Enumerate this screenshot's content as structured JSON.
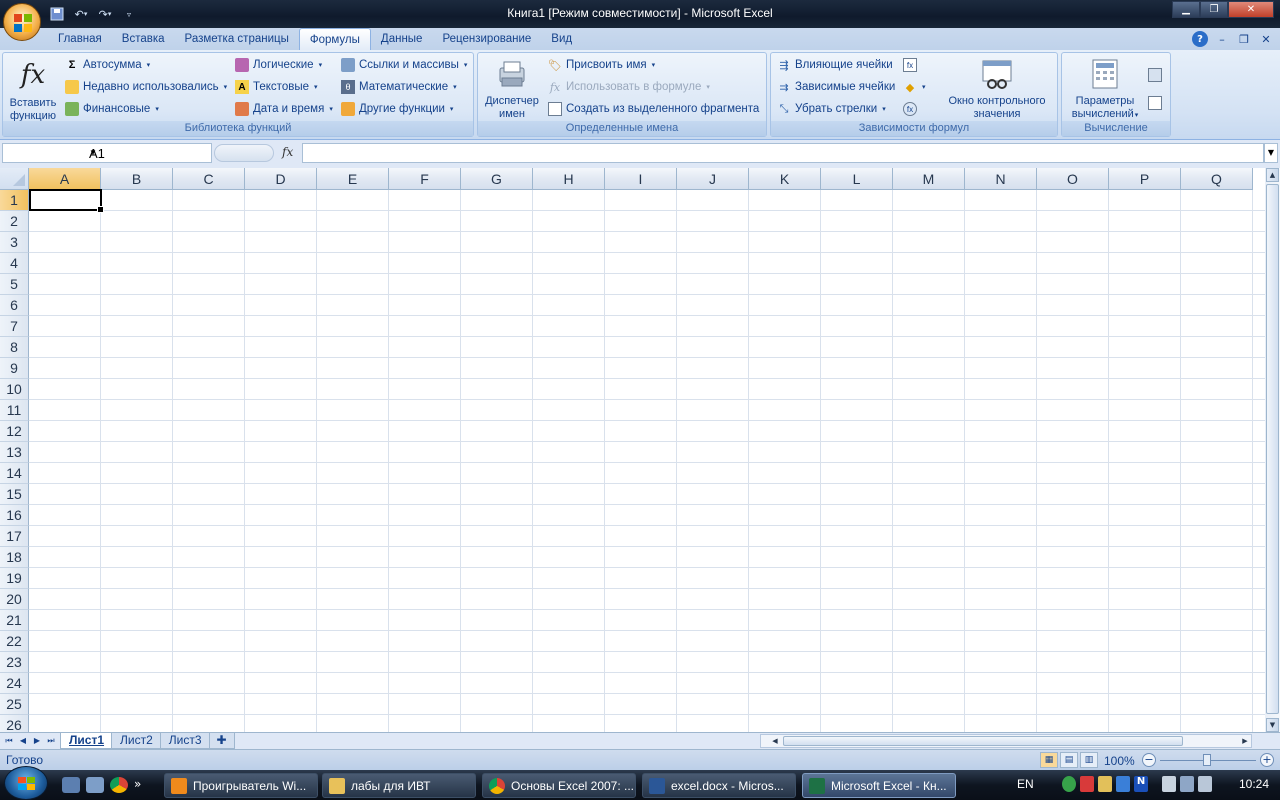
{
  "window": {
    "title": "Книга1  [Режим совместимости] - Microsoft Excel"
  },
  "tabs": [
    "Главная",
    "Вставка",
    "Разметка страницы",
    "Формулы",
    "Данные",
    "Рецензирование",
    "Вид"
  ],
  "active_tab": "Формулы",
  "ribbon": {
    "function_library": {
      "label": "Библиотека функций",
      "insert_function": "Вставить функцию",
      "insert_function_l1": "Вставить",
      "insert_function_l2": "функцию",
      "autosum": "Автосумма",
      "recent": "Недавно использовались",
      "financial": "Финансовые",
      "logical": "Логические",
      "text": "Текстовые",
      "datetime": "Дата и время",
      "lookup": "Ссылки и массивы",
      "math": "Математические",
      "more": "Другие функции"
    },
    "defined_names": {
      "label": "Определенные имена",
      "name_manager_l1": "Диспетчер",
      "name_manager_l2": "имен",
      "define_name": "Присвоить имя",
      "use_in_formula": "Использовать в формуле",
      "create_from_selection": "Создать из выделенного фрагмента"
    },
    "formula_auditing": {
      "label": "Зависимости формул",
      "trace_precedents": "Влияющие ячейки",
      "trace_dependents": "Зависимые ячейки",
      "remove_arrows": "Убрать стрелки",
      "watch_window_l1": "Окно контрольного",
      "watch_window_l2": "значения"
    },
    "calculation": {
      "label": "Вычисление",
      "options_l1": "Параметры",
      "options_l2": "вычислений"
    }
  },
  "formula_bar": {
    "name_box": "A1",
    "fx": "fx",
    "content": ""
  },
  "columns": [
    "A",
    "B",
    "C",
    "D",
    "E",
    "F",
    "G",
    "H",
    "I",
    "J",
    "K",
    "L",
    "M",
    "N",
    "O",
    "P",
    "Q"
  ],
  "rows": [
    "1",
    "2",
    "3",
    "4",
    "5",
    "6",
    "7",
    "8",
    "9",
    "10",
    "11",
    "12",
    "13",
    "14",
    "15",
    "16",
    "17",
    "18",
    "19",
    "20",
    "21",
    "22",
    "23",
    "24",
    "25",
    "26"
  ],
  "selected_cell": {
    "column": "A",
    "row": "1"
  },
  "sheets": [
    "Лист1",
    "Лист2",
    "Лист3"
  ],
  "active_sheet": "Лист1",
  "status": {
    "text": "Готово",
    "zoom": "100%"
  },
  "taskbar": {
    "items": [
      "Проигрыватель Wi...",
      "лабы для ИВТ",
      "Основы Excel 2007: ...",
      "excel.docx - Micros...",
      "Microsoft Excel - Кн..."
    ],
    "active_item": "Microsoft Excel - Кн...",
    "language": "EN",
    "clock": "10:24"
  },
  "colors": {
    "title_bar": "#0f1a2c",
    "ribbon_bg": "#dbe7f6",
    "selection_header": "#f1c15f",
    "text_blue": "#15428b"
  }
}
